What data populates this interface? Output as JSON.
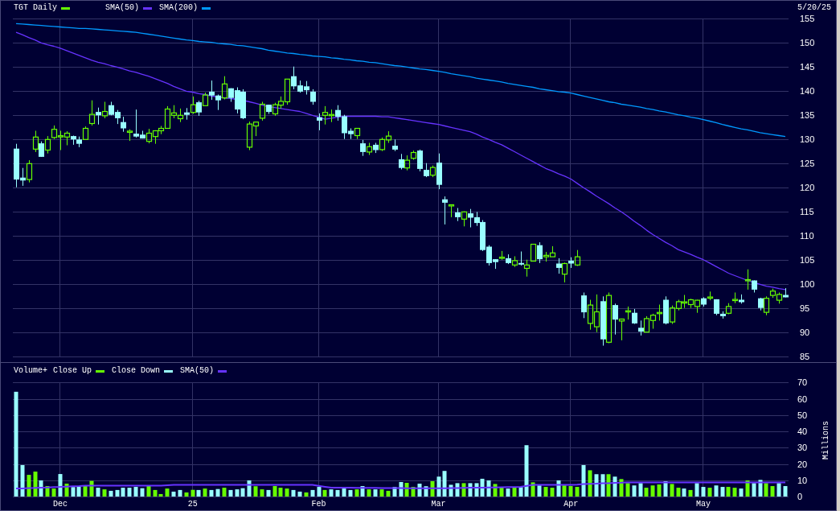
{
  "price_panel": {
    "date": "5/20/25",
    "chart_data": {
      "type": "candlestick",
      "title": "TGT Daily",
      "grid": true,
      "categories": [
        null,
        null,
        null,
        null,
        null,
        null,
        null,
        null,
        null,
        null,
        null,
        null,
        null,
        null,
        null,
        null,
        null,
        null,
        null,
        null,
        null,
        null,
        null,
        null,
        null,
        null,
        null,
        null,
        null,
        null,
        null,
        null,
        null,
        null,
        null,
        null,
        null,
        null,
        null,
        null,
        null,
        null,
        null,
        null,
        null,
        null,
        null,
        null,
        null,
        null,
        null,
        null,
        null,
        null,
        null,
        null,
        null,
        null,
        null,
        null,
        null,
        null,
        null,
        null,
        null,
        null,
        null,
        null,
        null,
        null,
        null,
        null,
        null,
        null,
        null,
        null,
        null,
        null,
        null,
        null,
        null,
        null,
        null,
        null,
        null,
        null,
        null,
        null,
        null,
        null,
        null,
        null,
        null,
        null,
        null,
        null,
        null,
        null,
        null,
        null,
        null,
        null,
        null,
        null,
        null,
        null,
        null,
        null,
        null,
        null,
        null,
        null,
        null,
        null,
        null,
        null,
        null,
        null,
        null,
        null,
        null,
        null,
        null
      ],
      "ylim": [
        85,
        155
      ],
      "yticks": [
        85,
        90,
        95,
        100,
        105,
        110,
        115,
        120,
        125,
        130,
        135,
        140,
        145,
        150,
        155
      ],
      "ohlc": [
        [
          128.1,
          129.1,
          120.1,
          121.7
        ],
        [
          122.1,
          124.1,
          120.4,
          121.5
        ],
        [
          121.7,
          125.7,
          121.1,
          125.0
        ],
        [
          128.0,
          131.8,
          127.4,
          130.5
        ],
        [
          129.2,
          129.6,
          126.4,
          126.4
        ],
        [
          127.8,
          130.7,
          127.1,
          130.0
        ],
        [
          130.4,
          132.9,
          130.1,
          132.1
        ],
        [
          130.6,
          131.8,
          127.8,
          130.7
        ],
        [
          130.5,
          131.7,
          128.8,
          131.3
        ],
        [
          130.7,
          130.8,
          128.9,
          130.0
        ],
        [
          130.0,
          130.6,
          128.4,
          129.1
        ],
        [
          130.0,
          132.7,
          130.0,
          132.3
        ],
        [
          133.3,
          138.1,
          132.9,
          135.2
        ],
        [
          135.7,
          136.6,
          133.1,
          135.0
        ],
        [
          134.9,
          137.8,
          134.4,
          135.8
        ],
        [
          137.1,
          137.8,
          135.0,
          135.1
        ],
        [
          135.7,
          136.1,
          133.2,
          134.4
        ],
        [
          133.6,
          134.7,
          131.6,
          132.3
        ],
        [
          131.5,
          132.1,
          129.7,
          131.7
        ],
        [
          131.2,
          136.2,
          130.4,
          130.6
        ],
        [
          131.0,
          131.8,
          130.2,
          130.2
        ],
        [
          129.6,
          132.2,
          129.2,
          131.3
        ],
        [
          130.6,
          131.9,
          129.1,
          131.8
        ],
        [
          131.8,
          132.8,
          131.1,
          132.3
        ],
        [
          132.3,
          136.9,
          132.3,
          136.3
        ],
        [
          135.0,
          137.1,
          134.4,
          135.5
        ],
        [
          134.3,
          136.4,
          133.6,
          135.0
        ],
        [
          135.6,
          136.5,
          134.1,
          135.1
        ],
        [
          135.6,
          138.9,
          135.3,
          137.2
        ],
        [
          137.7,
          138.0,
          134.9,
          135.6
        ],
        [
          137.0,
          139.7,
          137.0,
          139.2
        ],
        [
          139.9,
          142.2,
          138.2,
          139.1
        ],
        [
          139.1,
          139.3,
          136.1,
          138.1
        ],
        [
          138.6,
          143.1,
          138.3,
          141.5
        ],
        [
          140.6,
          140.6,
          137.8,
          138.6
        ],
        [
          140.2,
          140.8,
          135.4,
          136.2
        ],
        [
          139.9,
          140.4,
          134.2,
          134.4
        ],
        [
          128.4,
          133.7,
          127.8,
          133.2
        ],
        [
          132.8,
          133.7,
          130.7,
          133.6
        ],
        [
          134.4,
          137.8,
          133.9,
          137.3
        ],
        [
          137.2,
          137.2,
          135.3,
          135.7
        ],
        [
          135.3,
          137.6,
          134.9,
          137.2
        ],
        [
          137.1,
          138.9,
          136.4,
          137.9
        ],
        [
          137.8,
          142.5,
          137.2,
          142.5
        ],
        [
          143.1,
          145.1,
          140.4,
          141.0
        ],
        [
          141.2,
          142.2,
          139.7,
          139.9
        ],
        [
          141.0,
          142.1,
          139.3,
          140.2
        ],
        [
          139.9,
          140.4,
          137.2,
          137.8
        ],
        [
          134.6,
          135.4,
          131.9,
          133.9
        ],
        [
          135.0,
          136.9,
          133.1,
          135.6
        ],
        [
          135.0,
          136.2,
          133.6,
          135.1
        ],
        [
          136.1,
          137.1,
          133.9,
          134.7
        ],
        [
          134.8,
          135.1,
          130.1,
          131.3
        ],
        [
          131.8,
          132.3,
          130.1,
          131.1
        ],
        [
          130.8,
          132.3,
          130.1,
          132.3
        ],
        [
          129.2,
          129.9,
          126.6,
          127.4
        ],
        [
          127.4,
          129.3,
          126.8,
          128.5
        ],
        [
          128.9,
          129.3,
          127.2,
          127.8
        ],
        [
          127.9,
          130.4,
          127.6,
          130.0
        ],
        [
          129.9,
          131.7,
          129.3,
          130.7
        ],
        [
          128.7,
          130.0,
          127.6,
          127.9
        ],
        [
          125.9,
          127.0,
          123.8,
          124.1
        ],
        [
          124.1,
          126.7,
          123.6,
          125.7
        ],
        [
          126.1,
          127.7,
          125.8,
          127.3
        ],
        [
          127.7,
          127.9,
          123.4,
          123.9
        ],
        [
          123.7,
          125.1,
          122.2,
          122.4
        ],
        [
          122.6,
          124.6,
          122.2,
          124.2
        ],
        [
          125.2,
          127.1,
          119.7,
          120.6
        ],
        [
          117.6,
          118.2,
          112.4,
          116.9
        ],
        [
          116.3,
          116.5,
          113.9,
          116.4
        ],
        [
          114.9,
          115.8,
          113.1,
          113.9
        ],
        [
          113.5,
          115.1,
          112.0,
          115.0
        ],
        [
          114.7,
          115.6,
          111.8,
          113.8
        ],
        [
          113.9,
          115.0,
          112.1,
          112.7
        ],
        [
          112.9,
          113.3,
          106.9,
          107.1
        ],
        [
          107.8,
          108.1,
          103.9,
          104.4
        ],
        [
          105.2,
          105.2,
          103.2,
          104.6
        ],
        [
          105.4,
          106.9,
          105.1,
          105.6
        ],
        [
          105.4,
          106.2,
          104.2,
          104.4
        ],
        [
          104.0,
          105.8,
          103.6,
          104.9
        ],
        [
          104.4,
          106.8,
          103.9,
          104.1
        ],
        [
          103.3,
          105.1,
          101.6,
          104.0
        ],
        [
          104.8,
          108.3,
          104.8,
          108.3
        ],
        [
          108.1,
          108.7,
          104.4,
          105.2
        ],
        [
          105.7,
          106.7,
          104.7,
          106.0
        ],
        [
          105.7,
          107.9,
          105.7,
          106.5
        ],
        [
          104.3,
          105.4,
          102.2,
          103.4
        ],
        [
          102.1,
          104.5,
          100.4,
          104.3
        ],
        [
          104.9,
          105.6,
          103.4,
          104.3
        ],
        [
          104.0,
          107.1,
          103.8,
          105.7
        ],
        [
          97.7,
          98.3,
          93.0,
          94.2
        ],
        [
          91.9,
          96.8,
          90.6,
          95.7
        ],
        [
          91.2,
          97.9,
          90.1,
          94.3
        ],
        [
          96.5,
          97.5,
          87.3,
          88.6
        ],
        [
          88.0,
          98.3,
          87.8,
          97.7
        ],
        [
          95.7,
          96.0,
          89.6,
          92.7
        ],
        [
          92.4,
          92.9,
          88.4,
          92.8
        ],
        [
          94.3,
          95.4,
          92.7,
          94.5
        ],
        [
          94.1,
          94.9,
          91.8,
          91.9
        ],
        [
          91.0,
          92.5,
          89.4,
          90.2
        ],
        [
          90.1,
          93.4,
          90.1,
          92.9
        ],
        [
          92.5,
          93.9,
          90.8,
          93.6
        ],
        [
          94.0,
          95.8,
          92.5,
          94.1
        ],
        [
          96.8,
          97.5,
          91.7,
          91.9
        ],
        [
          92.2,
          95.6,
          91.8,
          95.1
        ],
        [
          95.0,
          96.8,
          94.6,
          96.4
        ],
        [
          96.2,
          97.8,
          95.1,
          96.3
        ],
        [
          95.8,
          97.0,
          95.1,
          96.8
        ],
        [
          95.4,
          96.8,
          94.1,
          96.7
        ],
        [
          97.1,
          97.3,
          95.4,
          95.8
        ],
        [
          97.2,
          98.5,
          96.7,
          97.3
        ],
        [
          96.9,
          96.9,
          93.6,
          93.9
        ],
        [
          93.9,
          94.4,
          92.9,
          93.4
        ],
        [
          94.0,
          96.1,
          93.8,
          95.4
        ],
        [
          96.7,
          98.3,
          96.1,
          96.8
        ],
        [
          96.8,
          97.9,
          96.0,
          96.3
        ],
        [
          100.8,
          103.1,
          98.9,
          100.9
        ],
        [
          100.8,
          100.8,
          98.3,
          98.9
        ],
        [
          97.1,
          97.2,
          94.6,
          95.1
        ],
        [
          94.2,
          97.5,
          93.6,
          97.1
        ],
        [
          97.7,
          99.1,
          97.2,
          98.6
        ],
        [
          96.7,
          98.3,
          96.0,
          97.9
        ],
        [
          97.8,
          99.2,
          97.3,
          97.3
        ]
      ],
      "series": [
        {
          "name": "SMA(50)",
          "type": "line",
          "color": "#6633ff",
          "values": [
            152.2,
            151.7,
            151.1,
            150.6,
            150.0,
            149.6,
            149.3,
            148.9,
            148.4,
            147.9,
            147.4,
            146.9,
            146.4,
            146.0,
            145.7,
            145.3,
            145.0,
            144.6,
            144.2,
            143.9,
            143.5,
            143.1,
            142.6,
            142.1,
            141.6,
            141.0,
            140.5,
            140.0,
            139.8,
            139.5,
            139.3,
            139.0,
            138.8,
            138.6,
            138.5,
            138.3,
            138.1,
            137.8,
            137.5,
            137.1,
            136.8,
            136.6,
            136.4,
            136.2,
            136.0,
            135.8,
            135.4,
            135.0,
            134.6,
            134.2,
            134.4,
            134.6,
            134.8,
            134.8,
            134.8,
            134.8,
            134.8,
            134.8,
            134.7,
            134.7,
            134.5,
            134.3,
            134.1,
            133.9,
            133.7,
            133.5,
            133.3,
            133.1,
            132.8,
            132.5,
            132.2,
            131.9,
            131.6,
            131.1,
            130.5,
            130.0,
            129.4,
            128.9,
            128.2,
            127.5,
            126.8,
            126.1,
            125.4,
            124.7,
            124.0,
            123.5,
            122.9,
            122.4,
            121.8,
            120.9,
            120.0,
            119.2,
            118.3,
            117.5,
            116.7,
            115.8,
            115.0,
            114.1,
            113.1,
            112.2,
            111.2,
            110.3,
            109.5,
            108.7,
            108.0,
            107.2,
            106.7,
            106.2,
            105.6,
            105.1,
            104.4,
            103.7,
            103.0,
            102.3,
            101.8,
            101.3,
            100.8,
            100.4,
            100.0,
            99.6,
            99.4,
            99.1,
            98.9
          ]
        },
        {
          "name": "SMA(200)",
          "type": "line",
          "color": "#0099ff",
          "values": [
            154.0,
            153.9,
            153.8,
            153.7,
            153.6,
            153.5,
            153.4,
            153.3,
            153.2,
            153.1,
            153.0,
            153.0,
            152.9,
            152.8,
            152.7,
            152.6,
            152.5,
            152.4,
            152.3,
            152.2,
            152.0,
            151.8,
            151.6,
            151.4,
            151.2,
            151.0,
            150.8,
            150.6,
            150.5,
            150.3,
            150.2,
            150.1,
            149.9,
            149.8,
            149.7,
            149.5,
            149.4,
            149.2,
            149.0,
            148.8,
            148.5,
            148.3,
            148.1,
            147.9,
            147.8,
            147.6,
            147.5,
            147.3,
            147.2,
            147.1,
            146.9,
            146.8,
            146.6,
            146.5,
            146.3,
            146.2,
            146.0,
            145.9,
            145.7,
            145.5,
            145.3,
            145.2,
            145.0,
            144.8,
            144.6,
            144.5,
            144.3,
            144.1,
            143.9,
            143.6,
            143.4,
            143.2,
            143.0,
            142.7,
            142.5,
            142.3,
            142.1,
            141.9,
            141.6,
            141.4,
            141.2,
            141.0,
            140.8,
            140.5,
            140.3,
            140.1,
            139.9,
            139.8,
            139.6,
            139.3,
            139.0,
            138.7,
            138.4,
            138.1,
            137.8,
            137.6,
            137.3,
            137.1,
            136.9,
            136.7,
            136.4,
            136.2,
            135.9,
            135.7,
            135.4,
            135.1,
            134.9,
            134.6,
            134.4,
            134.1,
            133.8,
            133.5,
            133.1,
            132.8,
            132.5,
            132.2,
            132.0,
            131.7,
            131.4,
            131.2,
            131.0,
            130.8,
            130.6
          ]
        }
      ]
    }
  },
  "volume_panel": {
    "chart_data": {
      "type": "bar",
      "title": "Volume+",
      "ylabel": "Millions",
      "grid": true,
      "categories": [
        null,
        null,
        null,
        null,
        null,
        null,
        null,
        "Dec",
        null,
        null,
        null,
        null,
        null,
        null,
        null,
        null,
        null,
        null,
        null,
        null,
        null,
        null,
        null,
        null,
        null,
        null,
        null,
        null,
        "25",
        null,
        null,
        null,
        null,
        null,
        null,
        null,
        null,
        null,
        null,
        null,
        null,
        null,
        null,
        null,
        null,
        null,
        null,
        null,
        "Feb",
        null,
        null,
        null,
        null,
        null,
        null,
        null,
        null,
        null,
        null,
        null,
        null,
        null,
        null,
        null,
        null,
        null,
        null,
        "Mar",
        null,
        null,
        null,
        null,
        null,
        null,
        null,
        null,
        null,
        null,
        null,
        null,
        null,
        null,
        null,
        null,
        null,
        null,
        null,
        null,
        "Apr",
        null,
        null,
        null,
        null,
        null,
        null,
        null,
        null,
        null,
        null,
        null,
        null,
        null,
        null,
        null,
        null,
        null,
        null,
        null,
        null,
        "May",
        null,
        null,
        null,
        null,
        null,
        null,
        null,
        null,
        null,
        null,
        null,
        null,
        null
      ],
      "ylim": [
        0,
        70
      ],
      "yticks": [
        0,
        10,
        20,
        30,
        40,
        50,
        60,
        70
      ],
      "series": [
        {
          "name": "Close Up",
          "color": "#66ff00",
          "values": [
            null,
            null,
            13.3,
            15.3,
            null,
            6.4,
            4.9,
            null,
            7.9,
            null,
            null,
            6.9,
            9.6,
            null,
            4.4,
            null,
            null,
            null,
            null,
            null,
            null,
            6.8,
            4.0,
            1.5,
            4.9,
            null,
            null,
            2.5,
            4.1,
            null,
            4.9,
            null,
            null,
            5.4,
            null,
            null,
            null,
            null,
            6.3,
            4.4,
            null,
            6.4,
            5.4,
            4.9,
            null,
            null,
            2.5,
            null,
            null,
            4.0,
            null,
            null,
            null,
            null,
            4.4,
            null,
            4.4,
            null,
            4.4,
            3.5,
            null,
            null,
            8.4,
            5.9,
            null,
            null,
            9.4,
            null,
            null,
            null,
            null,
            8.2,
            null,
            null,
            null,
            null,
            7.7,
            5.8,
            null,
            5.8,
            null,
            null,
            8.7,
            null,
            5.9,
            5.4,
            null,
            6.8,
            6.4,
            5.9,
            null,
            16.1,
            null,
            null,
            13.7,
            null,
            10.7,
            8.2,
            null,
            null,
            5.4,
            6.8,
            7.4,
            null,
            7.7,
            5.4,
            null,
            4.0,
            null,
            null,
            5.4,
            null,
            null,
            5.9,
            5.4,
            null,
            9.9,
            null,
            null,
            8.2,
            6.4,
            null,
            null
          ]
        },
        {
          "name": "Close Down",
          "color": "#99ffff",
          "values": [
            64.3,
            19.3,
            null,
            null,
            9.9,
            null,
            null,
            13.8,
            null,
            5.8,
            6.3,
            null,
            null,
            5.4,
            null,
            3.5,
            4.0,
            5.4,
            5.4,
            5.9,
            5.1,
            null,
            null,
            null,
            null,
            3.0,
            4.0,
            null,
            null,
            4.0,
            null,
            4.0,
            4.6,
            null,
            4.0,
            4.4,
            5.1,
            9.9,
            null,
            null,
            4.0,
            null,
            null,
            null,
            4.0,
            3.0,
            null,
            4.0,
            5.9,
            null,
            4.4,
            4.0,
            4.9,
            4.0,
            null,
            6.4,
            null,
            4.4,
            null,
            null,
            5.9,
            8.9,
            null,
            null,
            7.9,
            6.3,
            null,
            12.2,
            15.7,
            7.2,
            8.2,
            null,
            8.2,
            8.2,
            10.9,
            9.9,
            null,
            null,
            4.9,
            null,
            5.8,
            31.5,
            null,
            6.8,
            null,
            null,
            9.9,
            null,
            null,
            null,
            19.3,
            null,
            13.7,
            13.7,
            null,
            12.2,
            null,
            null,
            6.8,
            8.2,
            null,
            null,
            null,
            9.4,
            null,
            null,
            4.9,
            null,
            8.2,
            5.9,
            null,
            6.8,
            5.9,
            null,
            null,
            4.9,
            null,
            8.2,
            10.2,
            null,
            null,
            8.2,
            6.4
          ]
        },
        {
          "name": "SMA(50)",
          "type": "line",
          "color": "#6633ff",
          "values": [
            4.9,
            5.0,
            5.2,
            5.3,
            5.5,
            5.6,
            5.8,
            5.9,
            6.1,
            6.3,
            6.4,
            6.6,
            6.6,
            6.6,
            6.6,
            6.6,
            6.6,
            6.6,
            6.6,
            6.6,
            6.6,
            6.6,
            6.6,
            6.6,
            6.9,
            7.1,
            7.1,
            7.1,
            7.1,
            7.1,
            7.1,
            7.1,
            7.1,
            7.1,
            7.1,
            7.1,
            7.1,
            7.1,
            7.1,
            7.1,
            7.1,
            7.1,
            7.1,
            7.1,
            7.1,
            7.1,
            7.1,
            7.1,
            6.5,
            6.0,
            5.4,
            5.4,
            5.4,
            5.4,
            5.3,
            5.3,
            5.3,
            5.3,
            5.2,
            5.2,
            5.2,
            5.2,
            5.1,
            5.1,
            5.1,
            5.1,
            5.1,
            5.1,
            5.1,
            5.2,
            5.2,
            5.3,
            5.4,
            5.4,
            5.5,
            5.6,
            5.6,
            5.7,
            5.8,
            5.8,
            5.9,
            6.5,
            7.1,
            7.1,
            7.1,
            7.1,
            7.1,
            7.1,
            7.1,
            7.3,
            7.6,
            7.8,
            7.9,
            8.1,
            8.2,
            8.4,
            8.5,
            8.7,
            8.7,
            8.7,
            8.7,
            8.7,
            8.7,
            8.7,
            8.7,
            8.7,
            8.7,
            8.7,
            8.7,
            8.7,
            8.7,
            8.7,
            8.7,
            8.7,
            8.7,
            8.7,
            8.7,
            8.7,
            8.7,
            8.7,
            8.7,
            8.7,
            8.7
          ]
        }
      ]
    }
  }
}
